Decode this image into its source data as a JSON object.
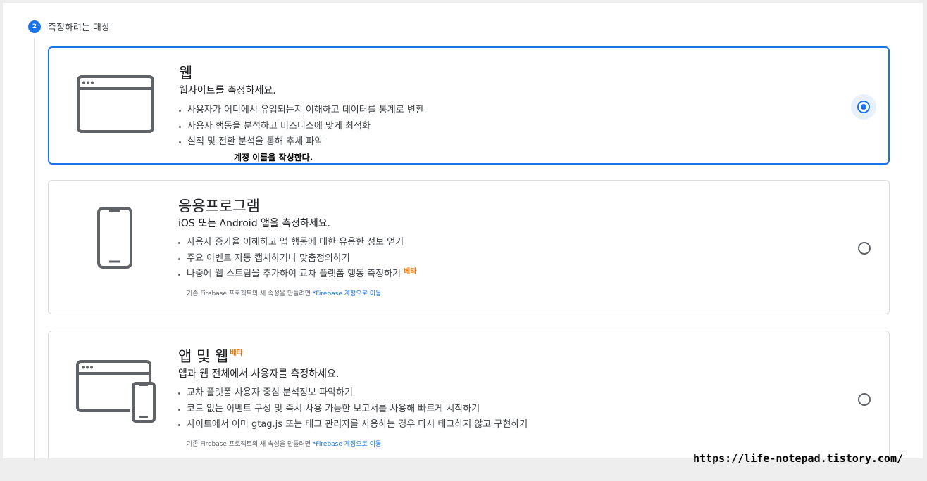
{
  "step": {
    "number": "2",
    "title": "측정하려는 대상"
  },
  "cards": [
    {
      "title": "웹",
      "subtitle": "웹사이트를 측정하세요.",
      "bullets": [
        "사용자가 어디에서 유입되는지 이해하고 데이터를 통계로 변환",
        "사용자 행동을 분석하고 비즈니스에 맞게 최적화",
        "실적 및 전환 분석을 통해 추세 파악"
      ],
      "overlay": "계정 이름을 작성한다.",
      "selected": true,
      "icon": "browser-window-icon"
    },
    {
      "title": "응용프로그램",
      "subtitle": "iOS 또는 Android 앱을 측정하세요.",
      "bullets": [
        "사용자 증가율 이해하고 앱 행동에 대한 유용한 정보 얻기",
        "주요 이벤트 자동 캡처하거나 맞춤정의하기",
        "나중에 웹 스트림을 추가하여 교차 플랫폼 행동 측정하기"
      ],
      "bullet_beta": "베타",
      "note_prefix": "기존 Firebase 프로젝트의 새 속성을 만들려면 ",
      "note_link": "*Firebase 계정으로 이동",
      "selected": false,
      "icon": "smartphone-icon"
    },
    {
      "title": "앱 및 웹",
      "title_beta": "베타",
      "subtitle": "앱과 웹 전체에서 사용자를 측정하세요.",
      "bullets": [
        "교차 플랫폼 사용자 중심 분석정보 파악하기",
        "코드 없는 이벤트 구성 및 즉시 사용 가능한 보고서를 사용해 빠르게 시작하기",
        "사이트에서 이미 gtag.js 또는 태그 관리자를 사용하는 경우 다시 태그하지 않고 구현하기"
      ],
      "note_prefix": "기존 Firebase 프로젝트의 새 속성을 만들려면 ",
      "note_link": "*Firebase 계정으로 이동",
      "selected": false,
      "icon": "browser-and-phone-icon"
    }
  ],
  "watermark": "https://life-notepad.tistory.com/",
  "colors": {
    "accent": "#1a73e8",
    "beta": "#e37400",
    "border": "#dadce0"
  }
}
